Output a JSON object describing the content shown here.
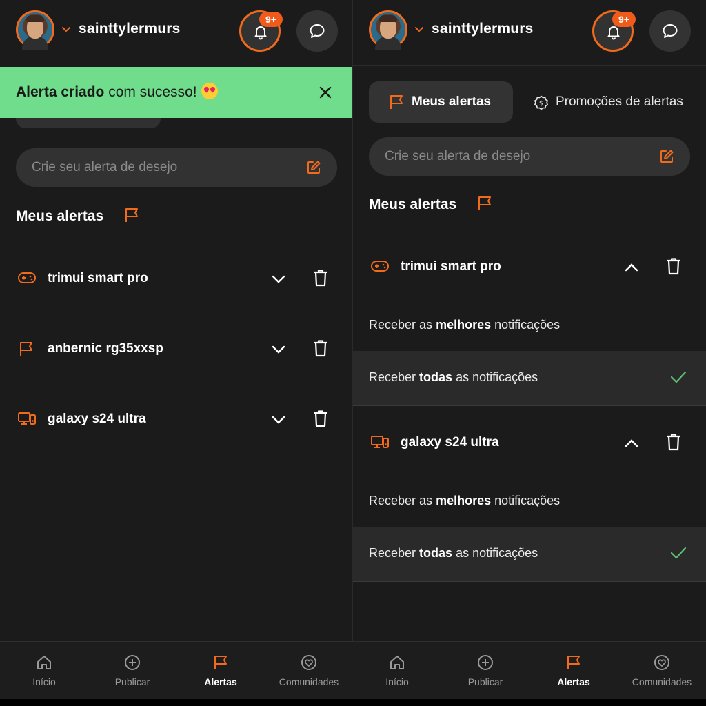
{
  "colors": {
    "accent": "#f26a1b",
    "toast_bg": "#6fdd8c",
    "check": "#5fbf6f",
    "background": "#1b1b1b"
  },
  "header": {
    "username": "sainttylermurs",
    "notification_badge": "9+",
    "icons": [
      "avatar",
      "chevron-down-icon",
      "bell-icon",
      "chat-bubble-icon"
    ]
  },
  "left": {
    "toast": {
      "bold": "Alerta criado",
      "rest": " com sucesso!",
      "emoji": "heart-eyes-emoji",
      "close_icon": "close-icon"
    },
    "search": {
      "placeholder": "Crie seu alerta de desejo",
      "icon": "edit-icon"
    },
    "section_title": "Meus alertas",
    "alerts": [
      {
        "label": "trimui smart pro",
        "icon": "gamepad-icon"
      },
      {
        "label": "anbernic rg35xxsp",
        "icon": "flag-icon"
      },
      {
        "label": "galaxy s24 ultra",
        "icon": "devices-icon"
      }
    ]
  },
  "right": {
    "tabs": {
      "active": "Meus alertas",
      "inactive": "Promoções de alertas"
    },
    "search": {
      "placeholder": "Crie seu alerta de desejo"
    },
    "section_title": "Meus alertas",
    "groups": [
      {
        "label": "trimui smart pro",
        "options": [
          {
            "pre": "Receber as ",
            "bold": "melhores",
            "post": " notificações",
            "selected": false
          },
          {
            "pre": "Receber ",
            "bold": "todas",
            "post": " as notificações",
            "selected": true
          }
        ]
      },
      {
        "label": "galaxy s24 ultra",
        "options": [
          {
            "pre": "Receber as ",
            "bold": "melhores",
            "post": " notificações",
            "selected": false
          },
          {
            "pre": "Receber ",
            "bold": "todas",
            "post": " as notificações",
            "selected": true
          }
        ]
      }
    ]
  },
  "nav": {
    "items": [
      {
        "label": "Início",
        "icon": "home-icon"
      },
      {
        "label": "Publicar",
        "icon": "plus-circle-icon"
      },
      {
        "label": "Alertas",
        "icon": "flag-icon",
        "active": true
      },
      {
        "label": "Comunidades",
        "icon": "heart-circle-icon"
      }
    ]
  }
}
